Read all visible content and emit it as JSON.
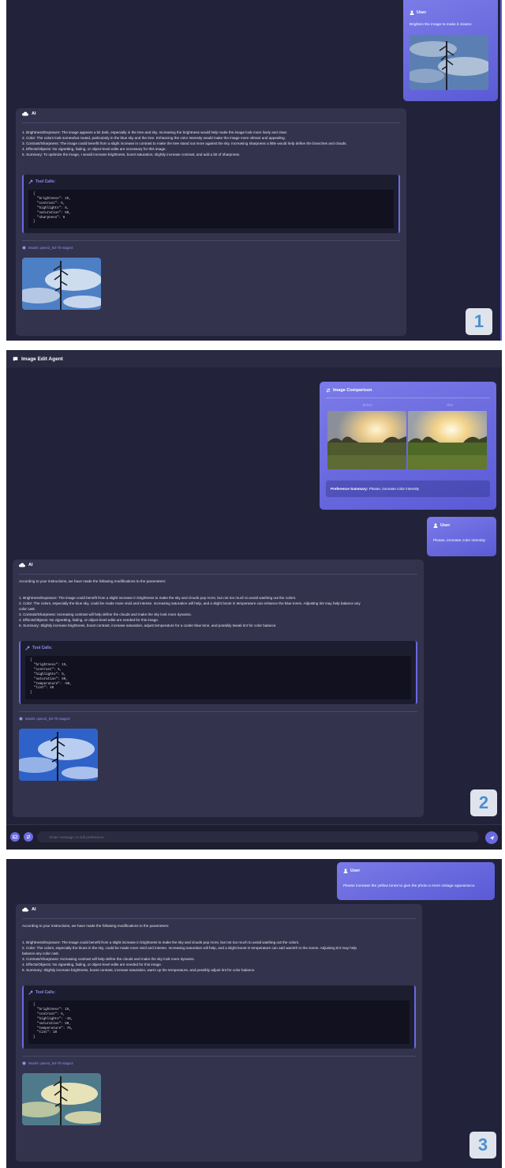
{
  "panel1": {
    "user": {
      "label": "User",
      "message": "Brighten the image to make it clearer."
    },
    "ai": {
      "label": "AI",
      "lines": [
        "1. Brightness/Exposure: The image appears a bit dark, especially in the tree and sky. Increasing the brightness would help make the image look more lively and clear.",
        "2. Color: The colors look somewhat muted, particularly in the blue sky and the tree. Enhancing the color intensity would make the image more vibrant and appealing.",
        "3. Contrast/Sharpness: The image could benefit from a slight increase in contrast to make the tree stand out more against the sky. Increasing sharpness a little would help define the branches and clouds.",
        "4. Effects/Objects: No vignetting, fading, or object-level edits are necessary for this image.",
        "5. Summary: To optimize the image, I would increase brightness, boost saturation, slightly increase contrast, and add a bit of sharpness."
      ],
      "tool_title": "Tool Calls:",
      "code": [
        "{",
        "  \"brightness\": 25,",
        "  \"contrast\": 5,",
        "  \"highlights\": 5,",
        "  \"saturation\": 50,",
        "  \"sharpness\": 5",
        "}"
      ],
      "model": "Model: qwen2_5vl-7b-stage3"
    },
    "badge": "1"
  },
  "panel2": {
    "app_title": "Image Edit Agent",
    "comparison": {
      "title": "Image Comparison",
      "before": "Before",
      "after": "After",
      "summary_label": "Preference Summary:",
      "summary_text": "Please, increase color intensity"
    },
    "user": {
      "label": "User",
      "message": "Please, increase color intensity"
    },
    "ai": {
      "label": "AI",
      "intro": "According to your instructions, we have made the following modifications to the parameters:",
      "lines": [
        "1. Brightness/Exposure: The image could benefit from a slight increase in brightness to make the sky and clouds pop more, but not too much to avoid washing out the colors.",
        "2. Color: The colors, especially the blue sky, could be made more vivid and intense. Increasing saturation will help, and a slight boost in temperature can enhance the blue tones. Adjusting tint may help balance any",
        "color cast.",
        "3. Contrast/Sharpness: Increasing contrast will help define the clouds and make the sky look more dynamic.",
        "4. Effects/Objects: No vignetting, fading, or object-level edits are needed for this image.",
        "5. Summary: Slightly increase brightness, boost contrast, increase saturation, adjust temperature for a cooler blue tone, and possibly tweak tint for color balance."
      ],
      "tool_title": "Tool Calls:",
      "code": [
        "{",
        "  \"brightness\": 15,",
        "  \"contrast\": 5,",
        "  \"highlights\": 5,",
        "  \"saturation\": 50,",
        "  \"temperature\": -80,",
        "  \"tint\": 10",
        "}"
      ],
      "model": "Model: qwen2_5vl-7b-stage3"
    },
    "input_placeholder": "Enter message or edit preference...",
    "badge": "2"
  },
  "panel3": {
    "user": {
      "label": "User",
      "message": "Please increase the yellow tones to give the photo a more vintage appearance."
    },
    "ai": {
      "label": "AI",
      "intro": "According to your instructions, we have made the following modifications to the parameters:",
      "lines": [
        "1. Brightness/Exposure: The image could benefit from a slight increase in brightness to make the sky and clouds pop more, but not too much to avoid washing out the colors.",
        "2. Color: The colors, especially the blues in the sky, could be made more vivid and intense. Increasing saturation will help, and a slight boost in temperature can add warmth to the scene. Adjusting tint may help",
        "balance any color cast.",
        "3. Contrast/Sharpness: Increasing contrast will help define the clouds and make the sky look more dynamic.",
        "4. Effects/Objects: No vignetting, fading, or object-level edits are needed for this image.",
        "5. Summary: Slightly increase brightness, boost contrast, increase saturation, warm up the temperature, and possibly adjust tint for color balance."
      ],
      "tool_title": "Tool Calls:",
      "code": [
        "{",
        "  \"brightness\": 15,",
        "  \"contrast\": 5,",
        "  \"highlights\": -15,",
        "  \"saturation\": 50,",
        "  \"temperature\": 75,",
        "  \"tint\": 10",
        "}"
      ],
      "model": "Model: qwen2_5vl-7b-stage3"
    },
    "badge": "3"
  },
  "colors": {
    "accent": "#6a6ae0",
    "panel_bg": "#22223a",
    "card_bg": "#33334d",
    "code_bg": "#111120",
    "badge_text": "#4a8fcf"
  }
}
